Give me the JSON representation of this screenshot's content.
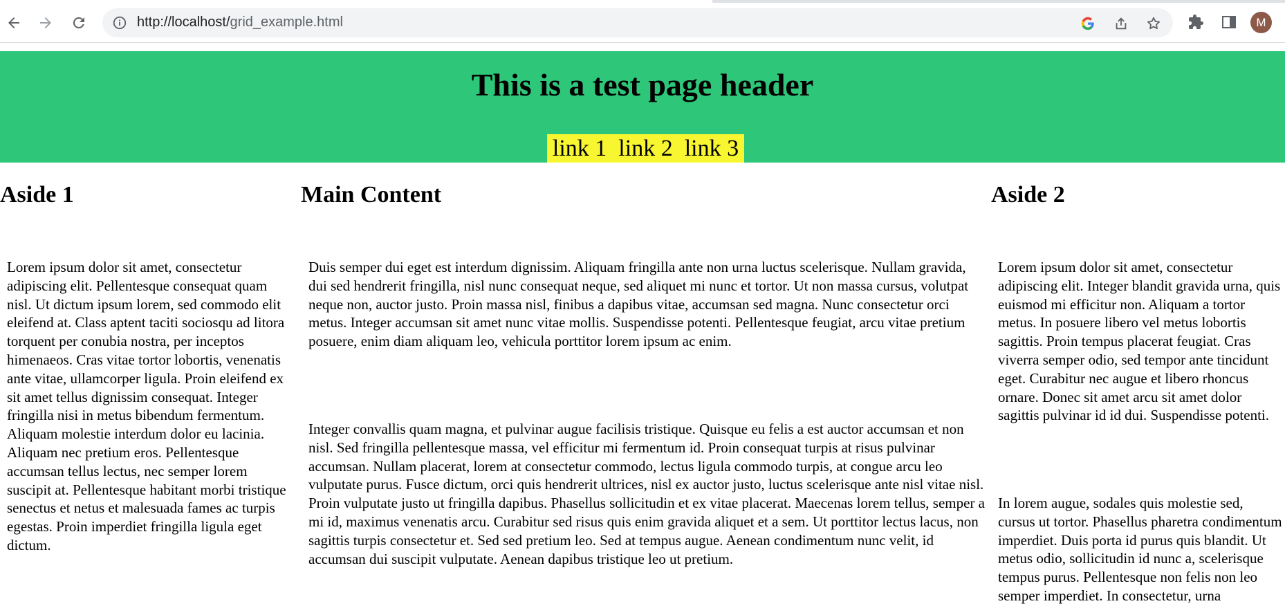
{
  "browser": {
    "url_host": "http://localhost/",
    "url_path": "grid_example.html",
    "avatar_letter": "M",
    "icons": [
      "back-arrow-icon",
      "forward-arrow-icon",
      "reload-icon",
      "site-info-icon",
      "google-icon",
      "share-icon",
      "bookmark-star-icon",
      "extensions-puzzle-icon",
      "side-panel-icon",
      "profile-avatar"
    ]
  },
  "header": {
    "title": "This is a test page header",
    "links": [
      "link 1",
      "link 2",
      "link 3"
    ],
    "background_color": "#2ec679",
    "links_background_color": "#f8f631"
  },
  "aside1": {
    "heading": "Aside 1",
    "paragraphs": [
      "Lorem ipsum dolor sit amet, consectetur adipiscing elit. Pellentesque consequat quam nisl. Ut dictum ipsum lorem, sed commodo elit eleifend at. Class aptent taciti sociosqu ad litora torquent per conubia nostra, per inceptos himenaeos. Cras vitae tortor lobortis, venenatis ante vitae, ullamcorper ligula. Proin eleifend ex sit amet tellus dignissim consequat. Integer fringilla nisi in metus bibendum fermentum. Aliquam molestie interdum dolor eu lacinia. Aliquam nec pretium eros. Pellentesque accumsan tellus lectus, nec semper lorem suscipit at. Pellentesque habitant morbi tristique senectus et netus et malesuada fames ac turpis egestas. Proin imperdiet fringilla ligula eget dictum."
    ]
  },
  "main": {
    "heading": "Main Content",
    "paragraphs": [
      "Duis semper dui eget est interdum dignissim. Aliquam fringilla ante non urna luctus scelerisque. Nullam gravida, dui sed hendrerit fringilla, nisl nunc consequat neque, sed aliquet mi nunc et tortor. Ut non massa cursus, volutpat neque non, auctor justo. Proin massa nisl, finibus a dapibus vitae, accumsan sed magna. Nunc consectetur orci metus. Integer accumsan sit amet nunc vitae mollis. Suspendisse potenti. Pellentesque feugiat, arcu vitae pretium posuere, enim diam aliquam leo, vehicula porttitor lorem ipsum ac enim.",
      "Integer convallis quam magna, et pulvinar augue facilisis tristique. Quisque eu felis a est auctor accumsan et non nisl. Sed fringilla pellentesque massa, vel efficitur mi fermentum id. Proin consequat turpis at risus pulvinar accumsan. Nullam placerat, lorem at consectetur commodo, lectus ligula commodo turpis, at congue arcu leo vulputate purus. Fusce dictum, orci quis hendrerit ultrices, nisl ex auctor justo, luctus scelerisque ante nisl vitae nisl. Proin vulputate justo ut fringilla dapibus. Phasellus sollicitudin et ex vitae placerat. Maecenas lorem tellus, semper a mi id, maximus venenatis arcu. Curabitur sed risus quis enim gravida aliquet et a sem. Ut porttitor lectus lacus, non sagittis turpis consectetur et. Sed sed pretium leo. Sed at tempus augue. Aenean condimentum nunc velit, id accumsan dui suscipit vulputate. Aenean dapibus tristique leo ut pretium."
    ]
  },
  "aside2": {
    "heading": "Aside 2",
    "paragraphs": [
      "Lorem ipsum dolor sit amet, consectetur adipiscing elit. Integer blandit gravida urna, quis euismod mi efficitur non. Aliquam a tortor metus. In posuere libero vel metus lobortis sagittis. Proin tempus placerat feugiat. Cras viverra semper odio, sed tempor ante tincidunt eget. Curabitur nec augue et libero rhoncus ornare. Donec sit amet arcu sit amet dolor sagittis pulvinar id id dui. Suspendisse potenti.",
      "In lorem augue, sodales quis molestie sed, cursus ut tortor. Phasellus pharetra condimentum imperdiet. Duis porta id purus quis blandit. Ut metus odio, sollicitudin id nunc a, scelerisque tempus purus. Pellentesque non felis non leo semper imperdiet. In consectetur, urna"
    ]
  }
}
